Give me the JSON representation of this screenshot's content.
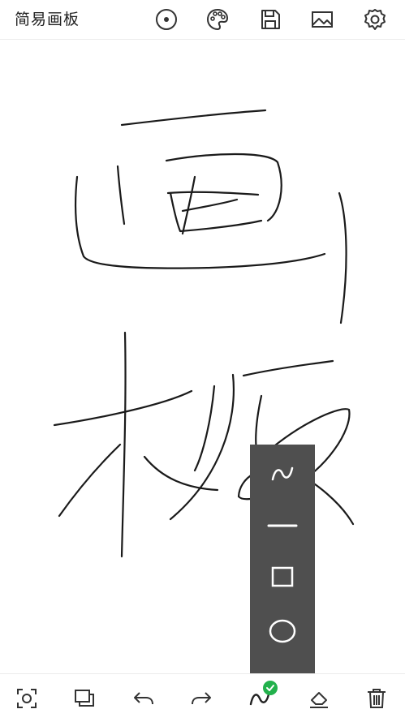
{
  "app": {
    "title": "简易画板"
  },
  "topbar": {
    "icons": [
      "brush-size-icon",
      "palette-icon",
      "save-icon",
      "image-icon",
      "settings-icon"
    ]
  },
  "shape_menu": {
    "items": [
      "freehand",
      "line",
      "rectangle",
      "circle"
    ],
    "active": "freehand"
  },
  "bottombar": {
    "icons": [
      "fit-screen-icon",
      "layers-icon",
      "undo-icon",
      "redo-icon",
      "pen-mode-icon",
      "eraser-icon",
      "delete-icon"
    ],
    "active": "pen-mode-icon"
  },
  "colors": {
    "stroke": "#1a1a1a",
    "panel": "#4f4f4f",
    "active_badge": "#22b14c",
    "icon": "#333333"
  }
}
